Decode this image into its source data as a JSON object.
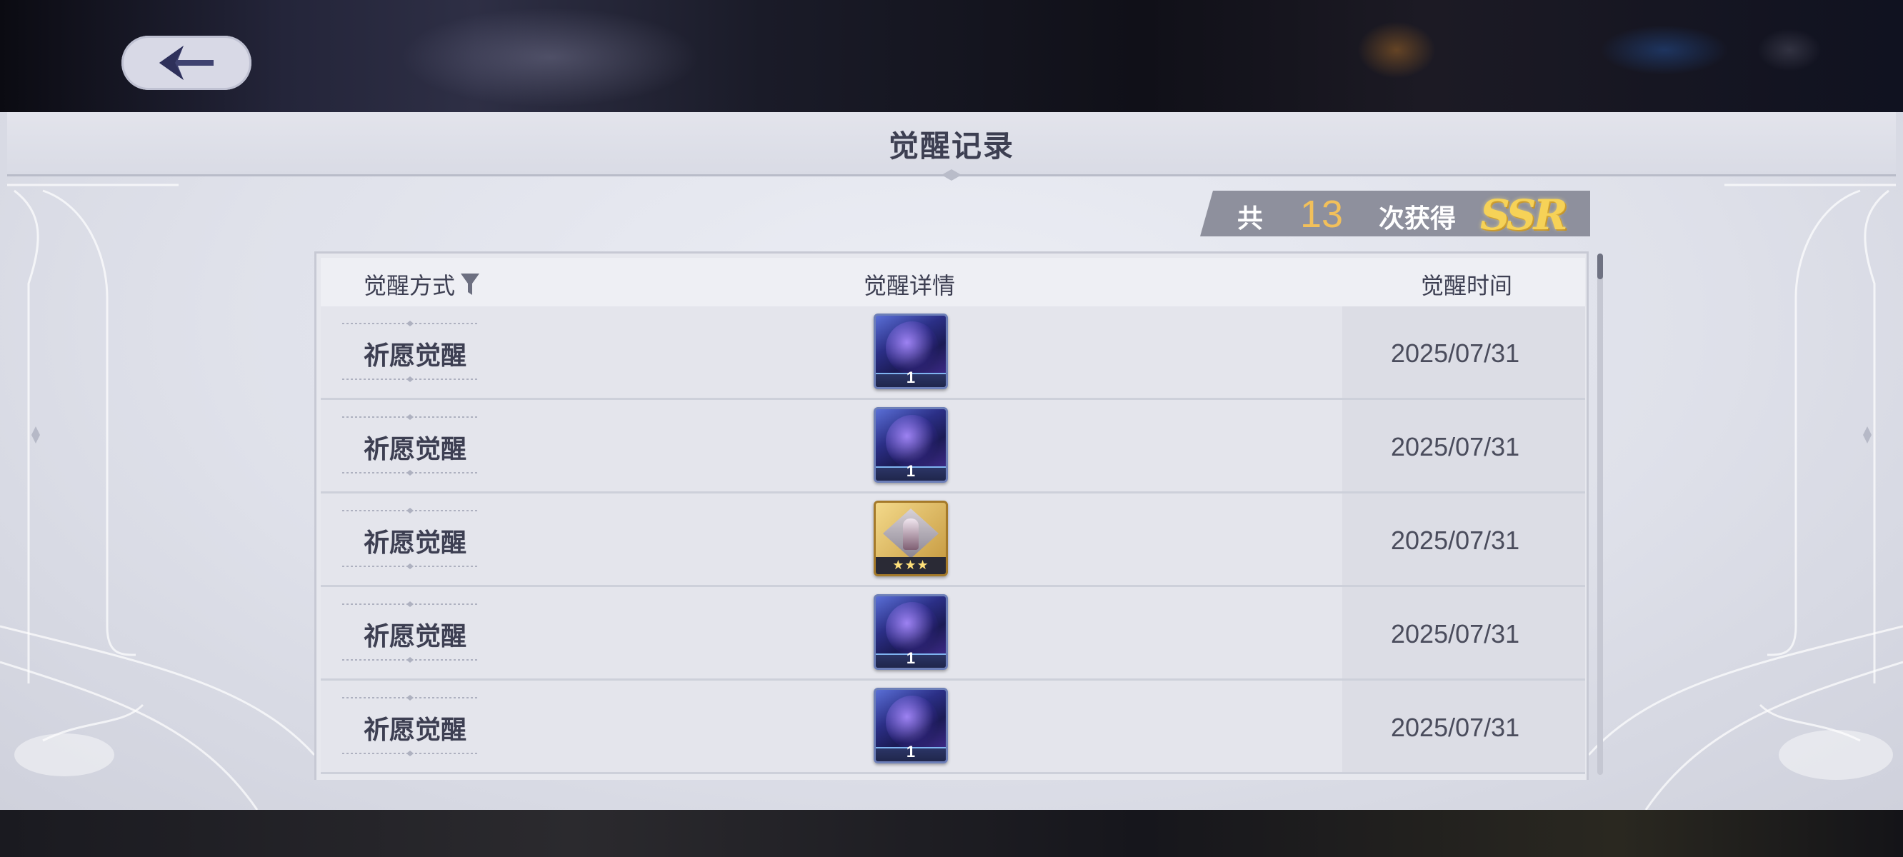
{
  "header": {
    "back_icon": "back-arrow-icon"
  },
  "panel": {
    "title": "觉醒记录"
  },
  "ssr_summary": {
    "prefix": "共",
    "count": "13",
    "middle": "次获得",
    "rarity": "SSR"
  },
  "table": {
    "columns": {
      "method": "觉醒方式",
      "detail": "觉醒详情",
      "time": "觉醒时间"
    },
    "filter_icon": "filter-icon",
    "rows": [
      {
        "method": "祈愿觉醒",
        "item_quantity": "1",
        "item_kind": "blue-card",
        "date": "2025/07/31"
      },
      {
        "method": "祈愿觉醒",
        "item_quantity": "1",
        "item_kind": "blue-card",
        "date": "2025/07/31"
      },
      {
        "method": "祈愿觉醒",
        "item_stars": "★★★",
        "item_kind": "gold-character",
        "date": "2025/07/31"
      },
      {
        "method": "祈愿觉醒",
        "item_quantity": "1",
        "item_kind": "blue-card",
        "date": "2025/07/31"
      },
      {
        "method": "祈愿觉醒",
        "item_quantity": "1",
        "item_kind": "blue-card",
        "date": "2025/07/31"
      }
    ]
  },
  "colors": {
    "accent_gold": "#f2c05a",
    "panel_bg": "#dfe1ea",
    "text_dark": "#3d3f52"
  }
}
